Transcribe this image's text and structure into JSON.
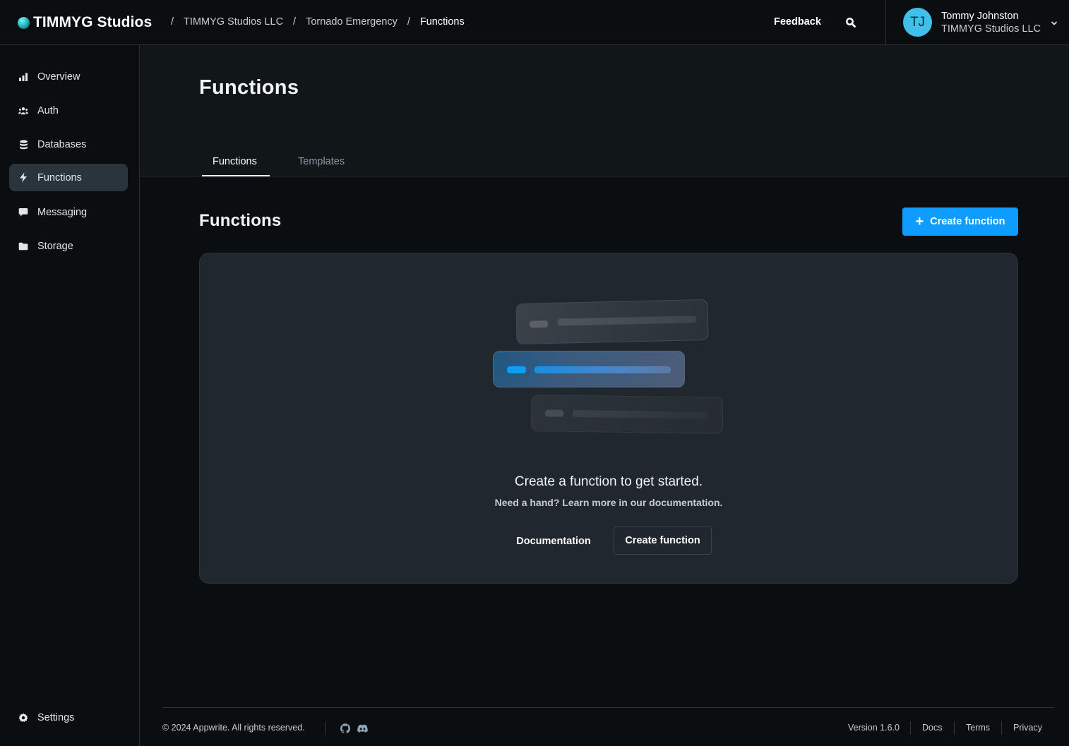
{
  "header": {
    "brand": "TIMMYG Studios",
    "breadcrumbs": [
      {
        "label": "TIMMYG Studios LLC"
      },
      {
        "label": "Tornado Emergency"
      },
      {
        "label": "Functions"
      }
    ],
    "separator": "/",
    "feedback_label": "Feedback",
    "search_icon": "search-icon",
    "user": {
      "initials": "TJ",
      "name": "Tommy Johnston",
      "org": "TIMMYG Studios LLC",
      "avatar_color": "#3fc0ec"
    }
  },
  "sidebar": {
    "items": [
      {
        "label": "Overview",
        "icon": "bar-chart-icon",
        "active": false
      },
      {
        "label": "Auth",
        "icon": "users-icon",
        "active": false
      },
      {
        "label": "Databases",
        "icon": "database-icon",
        "active": false
      },
      {
        "label": "Functions",
        "icon": "lightning-icon",
        "active": true
      },
      {
        "label": "Messaging",
        "icon": "chat-icon",
        "active": false
      },
      {
        "label": "Storage",
        "icon": "folder-icon",
        "active": false
      }
    ],
    "settings_label": "Settings"
  },
  "main": {
    "page_title": "Functions",
    "tabs": [
      {
        "label": "Functions",
        "active": true
      },
      {
        "label": "Templates",
        "active": false
      }
    ],
    "section_title": "Functions",
    "create_button_label": "Create function",
    "accent_color": "#0f9cff",
    "empty_state": {
      "title": "Create a function to get started.",
      "subtitle": "Need a hand? Learn more in our documentation.",
      "documentation_label": "Documentation",
      "create_label": "Create function"
    }
  },
  "footer": {
    "copyright": "© 2024 Appwrite. All rights reserved.",
    "social_icons": [
      "github-icon",
      "discord-icon"
    ],
    "version": "Version 1.6.0",
    "links": [
      {
        "label": "Docs"
      },
      {
        "label": "Terms"
      },
      {
        "label": "Privacy"
      }
    ]
  }
}
